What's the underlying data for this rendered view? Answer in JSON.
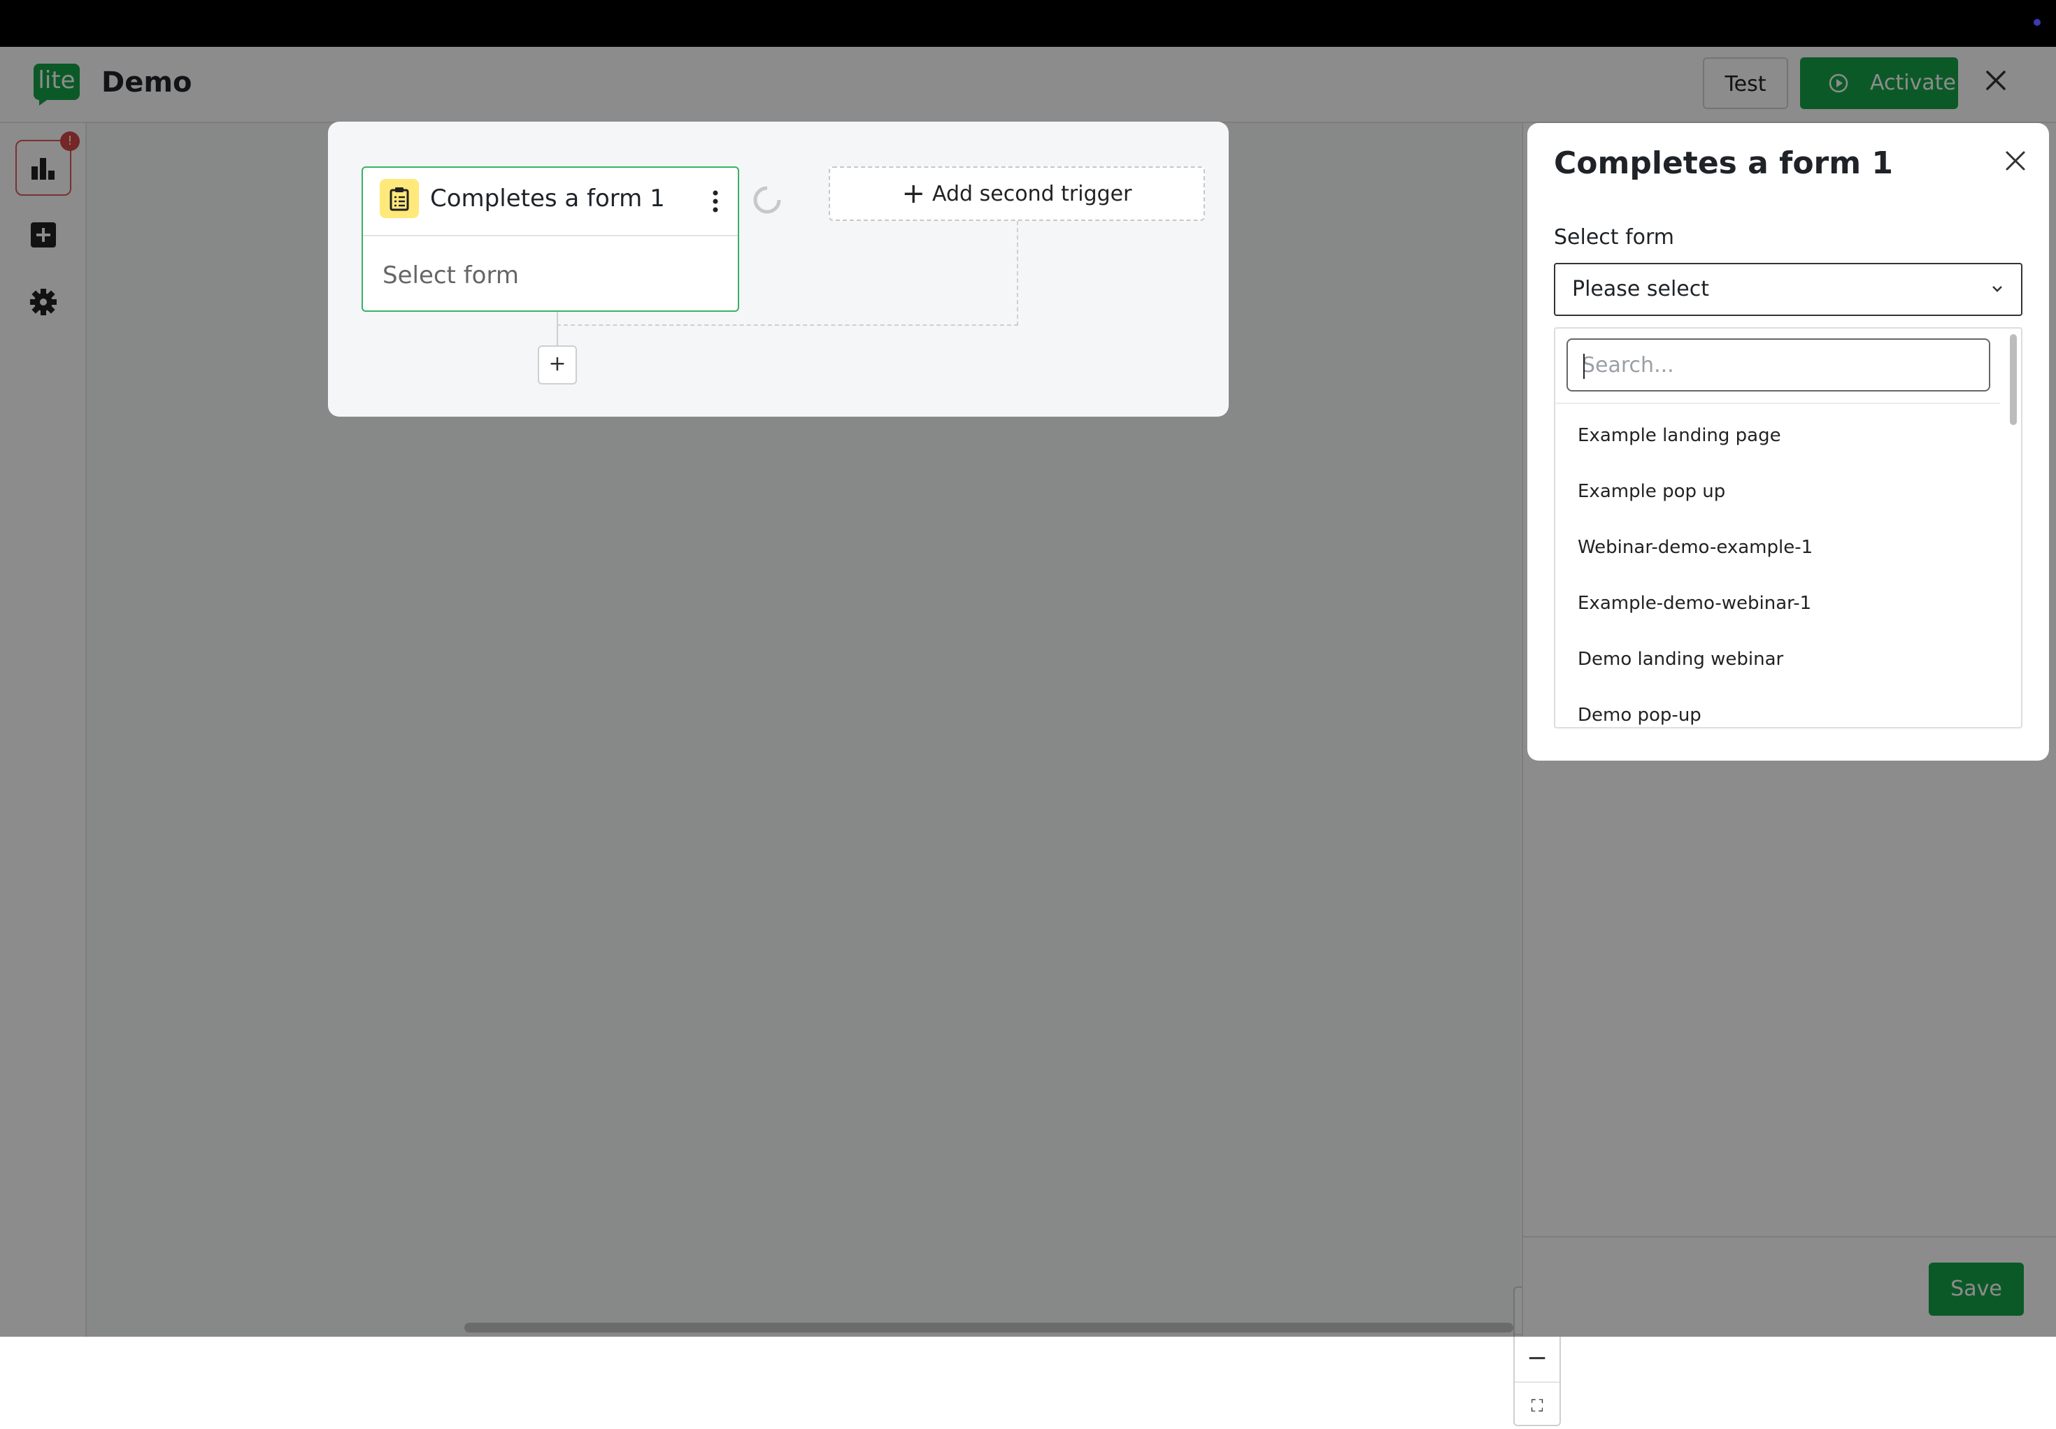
{
  "app": {
    "logo_text": "lite",
    "title": "Demo"
  },
  "header": {
    "test_label": "Test",
    "activate_label": "Activate"
  },
  "sidebar": {
    "badge": "!"
  },
  "workflow": {
    "trigger_title": "Completes a form 1",
    "trigger_body": "Select form",
    "second_trigger_label": "Add second trigger",
    "add_step": "+"
  },
  "zoom": {
    "in": "+",
    "out": "−",
    "fit": "⛶"
  },
  "panel": {
    "title": "Completes a form 1",
    "field_label": "Select form",
    "select_value": "Please select",
    "search_placeholder": "Search...",
    "options": [
      "Example landing page",
      "Example pop up",
      "Webinar-demo-example-1",
      "Example-demo-webinar-1",
      "Demo landing webinar",
      "Demo pop-up"
    ],
    "save_label": "Save"
  },
  "colors": {
    "accent": "#17a34a",
    "badge": "#d64545",
    "node_icon_bg": "#ffe97a"
  }
}
